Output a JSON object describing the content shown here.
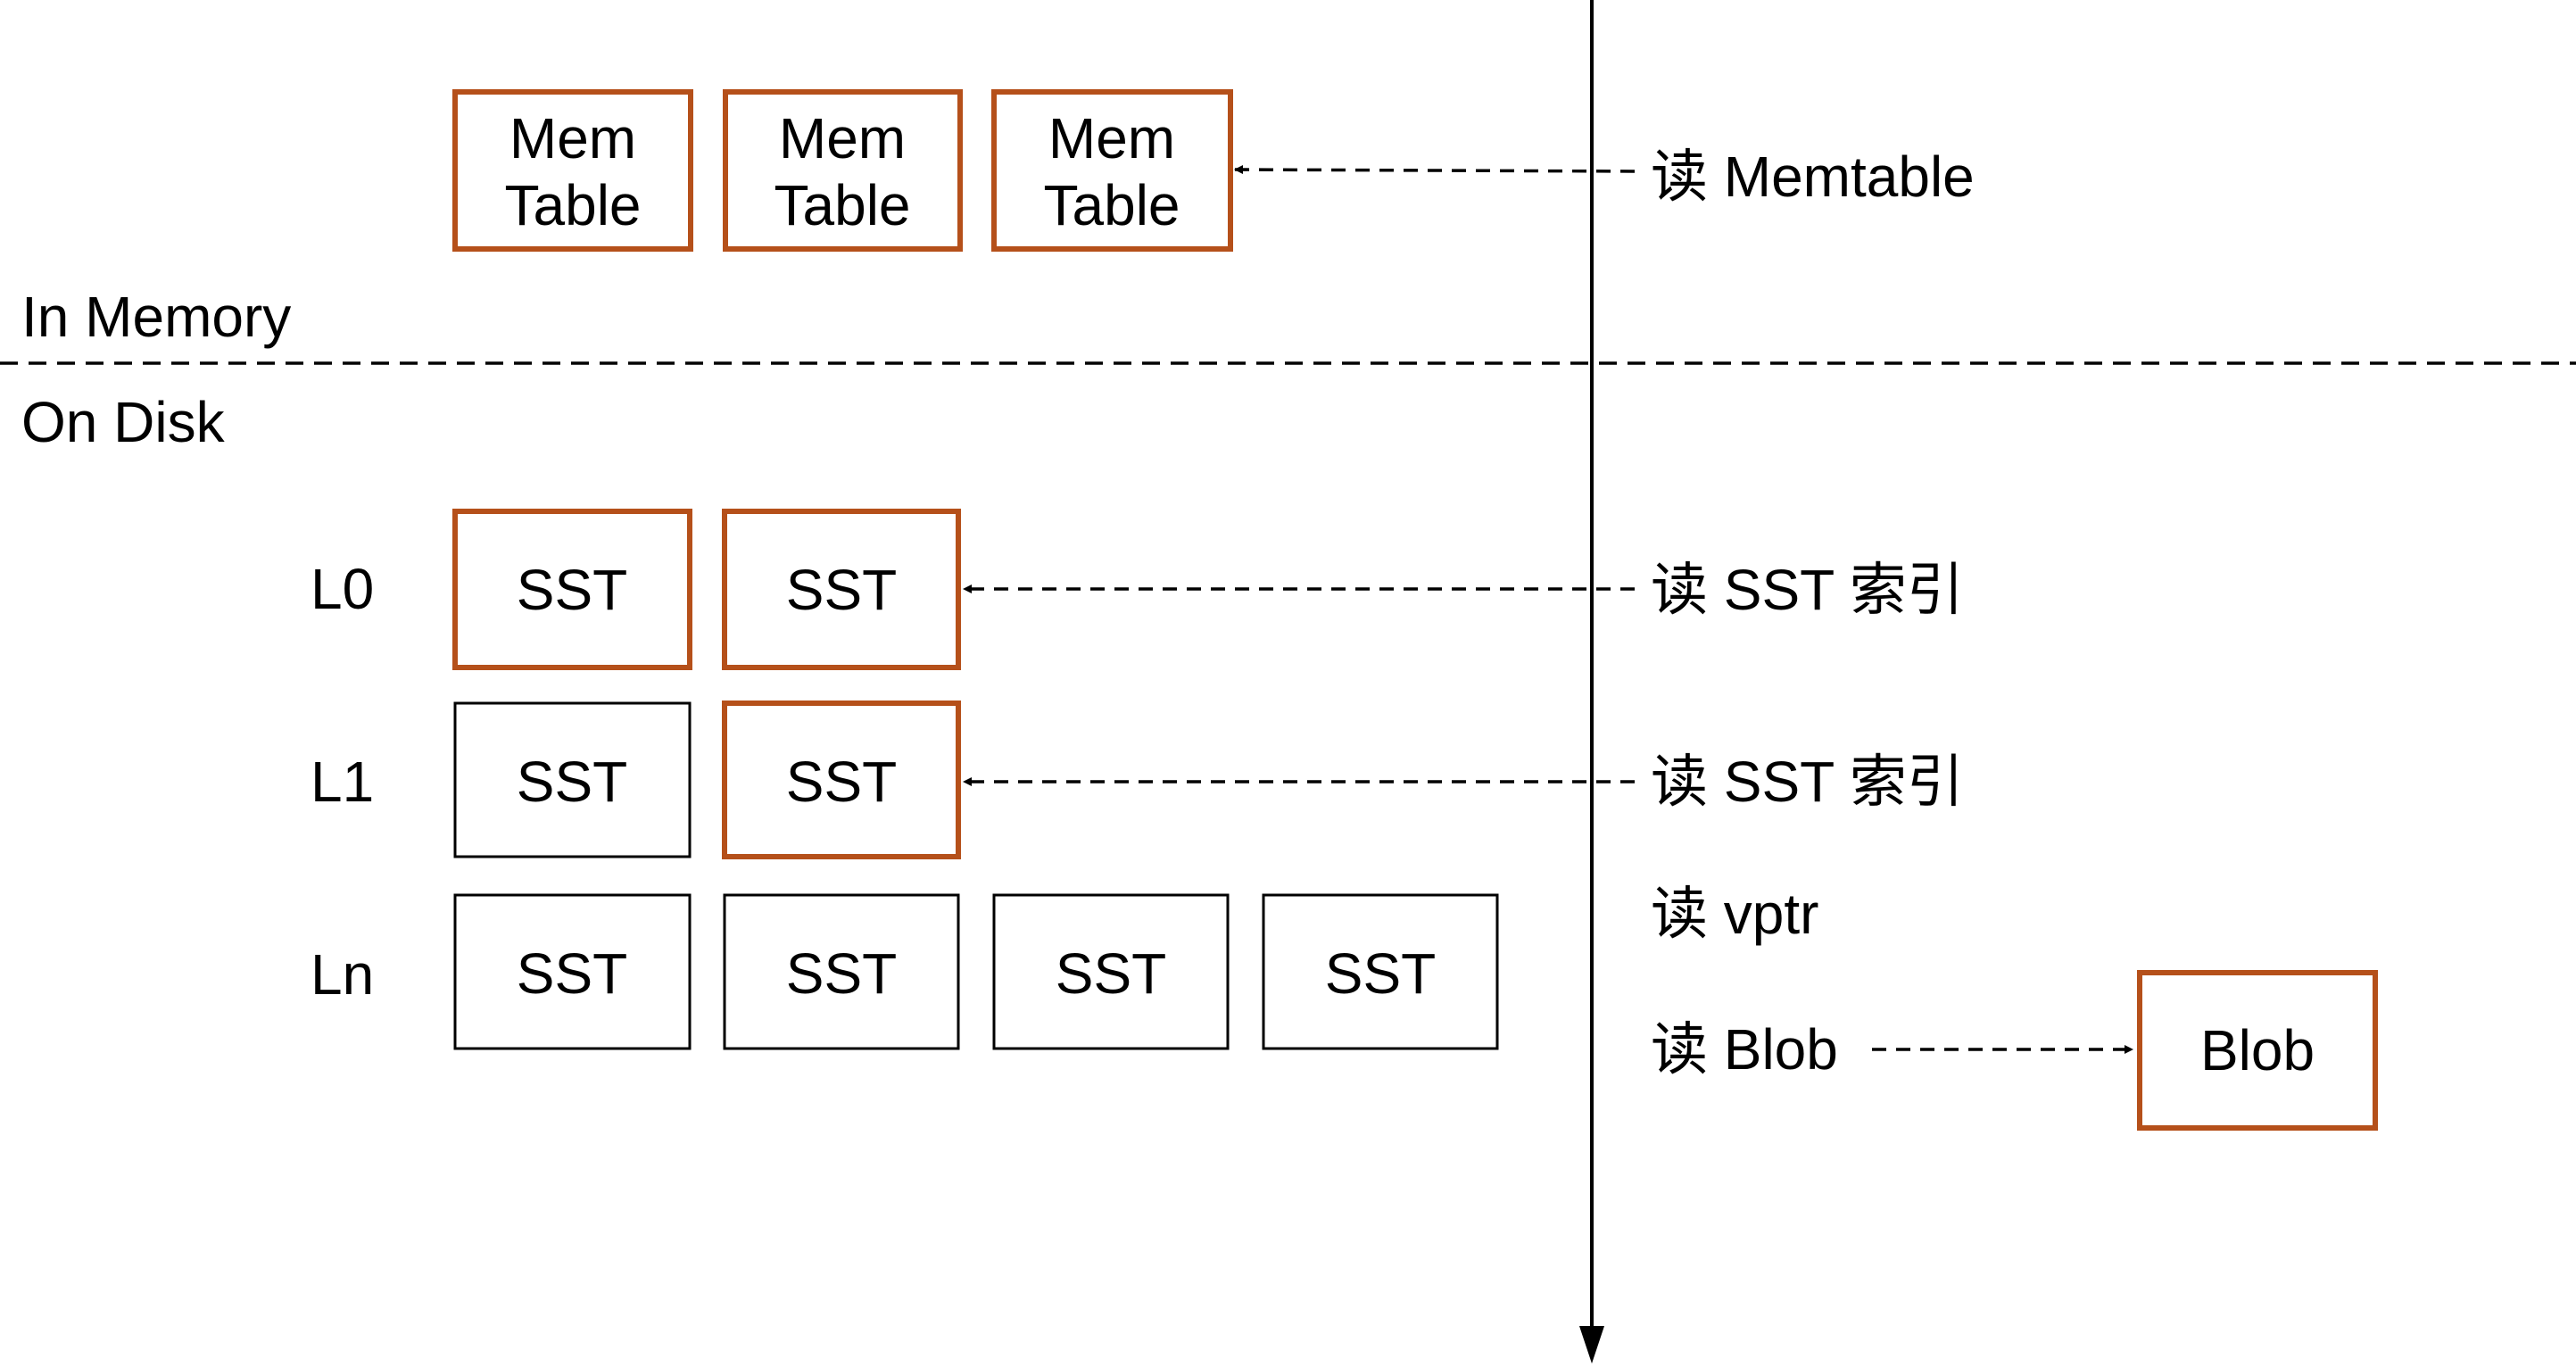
{
  "colors": {
    "highlight": "#b5501a",
    "normal": "#000000",
    "background": "#ffffff"
  },
  "regions": {
    "in_memory": "In Memory",
    "on_disk": "On Disk"
  },
  "memtables": [
    {
      "line1": "Mem",
      "line2": "Table",
      "highlighted": true
    },
    {
      "line1": "Mem",
      "line2": "Table",
      "highlighted": true
    },
    {
      "line1": "Mem",
      "line2": "Table",
      "highlighted": true
    }
  ],
  "levels": [
    {
      "label": "L0",
      "tables": [
        {
          "label": "SST",
          "highlighted": true
        },
        {
          "label": "SST",
          "highlighted": true
        }
      ]
    },
    {
      "label": "L1",
      "tables": [
        {
          "label": "SST",
          "highlighted": false
        },
        {
          "label": "SST",
          "highlighted": true
        }
      ]
    },
    {
      "label": "Ln",
      "tables": [
        {
          "label": "SST",
          "highlighted": false
        },
        {
          "label": "SST",
          "highlighted": false
        },
        {
          "label": "SST",
          "highlighted": false
        },
        {
          "label": "SST",
          "highlighted": false
        }
      ]
    }
  ],
  "read_steps": [
    {
      "id": "memtable",
      "text": "读 Memtable"
    },
    {
      "id": "sst_l0",
      "text": "读 SST 索引"
    },
    {
      "id": "sst_l1",
      "text": "读 SST 索引"
    },
    {
      "id": "vptr",
      "text": "读 vptr"
    },
    {
      "id": "blob",
      "text": "读 Blob"
    }
  ],
  "blob": {
    "label": "Blob",
    "highlighted": true
  }
}
